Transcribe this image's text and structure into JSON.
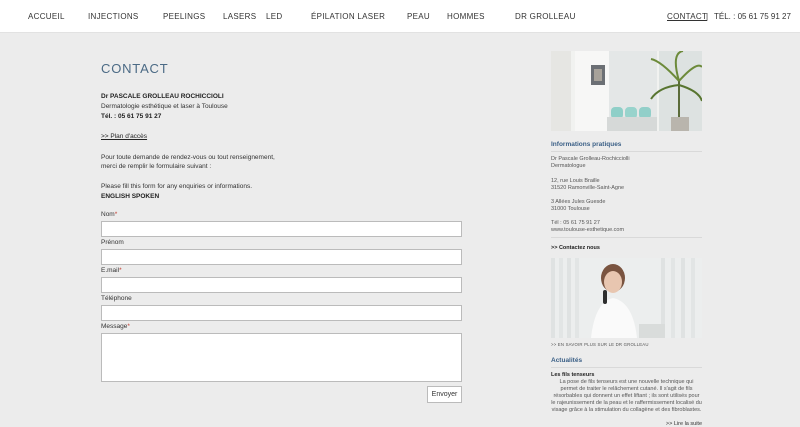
{
  "nav": {
    "items": [
      "ACCUEIL",
      "INJECTIONS",
      "PEELINGS",
      "LASERS",
      "LED",
      "ÉPILATION LASER",
      "PEAU",
      "HOMMES",
      "DR GROLLEAU"
    ],
    "contact": "CONTACT",
    "separator": "|",
    "phone": "TÉL. : 05 61 75 91 27"
  },
  "main": {
    "title": "CONTACT",
    "doctor_name": "Dr PASCALE GROLLEAU ROCHICCIOLI",
    "doctor_subtitle": "Dermatologie esthétique et laser à Toulouse",
    "doctor_tel": "Tél. : 05 61 75 91 27",
    "plan_link": ">> Plan d'accès",
    "intro_line1": "Pour toute demande de rendez-vous ou tout renseignement,",
    "intro_line2": "merci de remplir le formulaire suivant :",
    "english_line": "Please fill this form for any enquiries or informations.",
    "english_spoken": "ENGLISH SPOKEN"
  },
  "form": {
    "nom_label": "Nom",
    "prenom_label": "Prénom",
    "email_label": "E.mail",
    "telephone_label": "Téléphone",
    "message_label": "Message",
    "required_mark": "*",
    "submit_label": "Envoyer"
  },
  "sidebar": {
    "info_heading": "Informations pratiques",
    "info_name": "Dr Pascale Grolleau-Rochicciolli",
    "info_title": "Dermatologue",
    "addr1_line1": "12, rue Louis Braille",
    "addr1_line2": "31520 Ramonville-Saint-Agne",
    "addr2_line1": "3 Allées Jules Guesde",
    "addr2_line2": "31000 Toulouse",
    "tel": "Tél : 05 61 75 91 27",
    "website": "www.toulouse-esthetique.com",
    "contact_link": ">> Contactez nous",
    "more_about": ">> EN SAVOIR PLUS SUR LE DR GROLLEAU",
    "news_heading": "Actualités",
    "news_title": "Les fils tenseurs",
    "news_body": "La pose de fils tenseurs est une nouvelle technique qui permet de traiter le relâchement cutané. Il s'agit de fils résorbables qui donnent un effet liftant ; ils sont utilisés pour le rajeunissement de la peau et le raffermissement localisé du visage grâce à la stimulation du collagène et des fibroblastes.",
    "news_more": ">> Lire la suite"
  }
}
